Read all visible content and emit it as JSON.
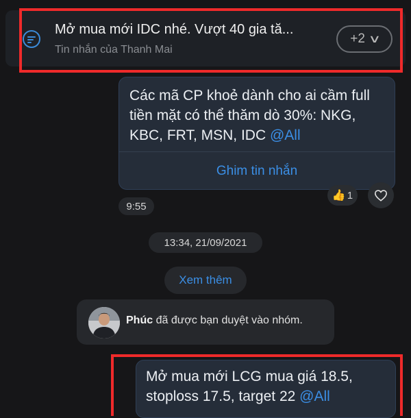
{
  "pinned": {
    "title": "Mở mua mới IDC nhé. Vượt 40 gia tă...",
    "subtitle": "Tin nhắn của Thanh Mai",
    "more_count": "+2",
    "icon": "pinned-list-icon"
  },
  "message1": {
    "text": "Các mã CP khoẻ dành cho ai cầm full tiền mặt có thể thăm dò 30%: NKG, KBC, FRT, MSN, IDC",
    "mention": "@All",
    "action_label": "Ghim tin nhắn",
    "reaction_count": "1",
    "reaction_icon": "thumbs-up-icon",
    "time": "9:55"
  },
  "date_separator": "13:34, 21/09/2021",
  "see_more_label": "Xem thêm",
  "system_message": {
    "name": "Phúc",
    "text": "đã được bạn duyệt vào nhóm."
  },
  "message2": {
    "text": "Mở mua mới LCG mua giá 18.5, stoploss 17.5, target 22",
    "mention": "@All"
  },
  "colors": {
    "accent": "#3b8fe6",
    "highlight": "#ef2a2a",
    "bubble": "#252d39",
    "background": "#161618"
  }
}
